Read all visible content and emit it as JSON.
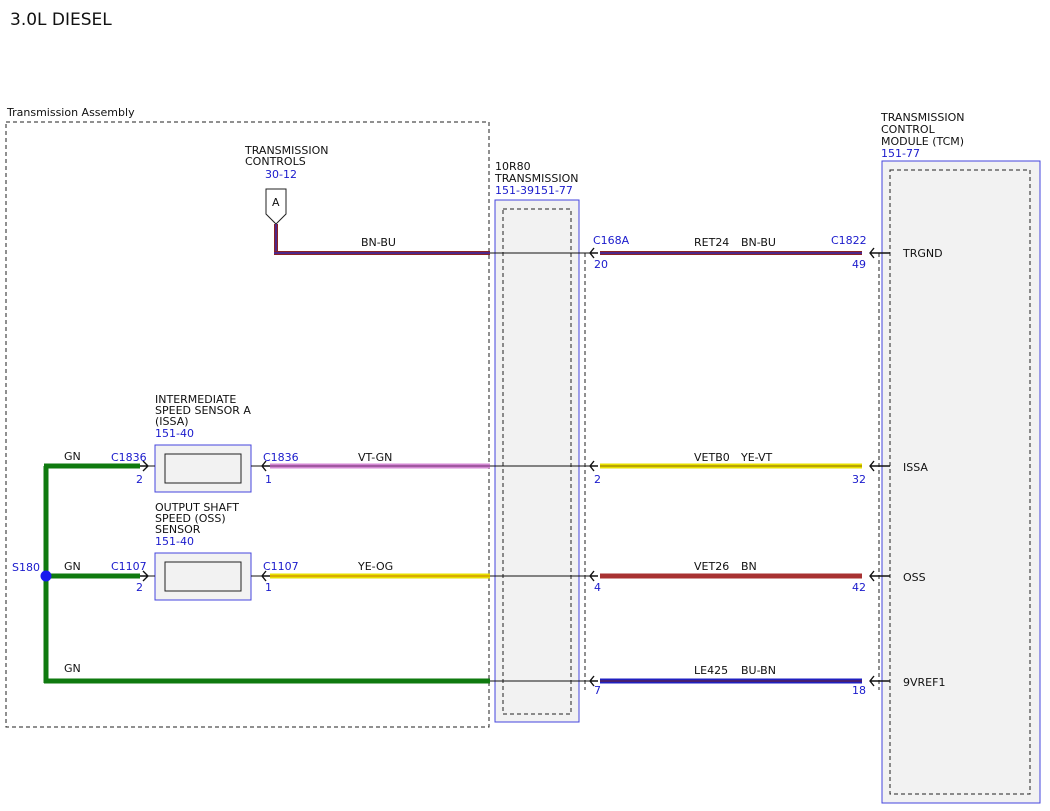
{
  "title": "3.0L DIESEL",
  "transmission_assembly": {
    "label": "Transmission Assembly"
  },
  "transmission_controls": {
    "name_line1": "TRANSMISSION",
    "name_line2": "CONTROLS",
    "ref": "30-12",
    "marker": "A"
  },
  "transmission_10r80": {
    "name_line1": "10R80",
    "name_line2": "TRANSMISSION",
    "ref": "151-39151-77"
  },
  "tcm": {
    "name_line1": "TRANSMISSION",
    "name_line2": "CONTROL",
    "name_line3": "MODULE (TCM)",
    "ref": "151-77"
  },
  "issa_sensor": {
    "name_line1": "INTERMEDIATE",
    "name_line2": "SPEED SENSOR A",
    "name_line3": "(ISSA)",
    "ref": "151-40",
    "left_connector": "C1836",
    "left_pin": "2",
    "right_connector": "C1836",
    "right_pin": "1"
  },
  "oss_sensor": {
    "name_line1": "OUTPUT SHAFT",
    "name_line2": "SPEED (OSS)",
    "name_line3": "SENSOR",
    "ref": "151-40",
    "left_connector": "C1107",
    "left_pin": "2",
    "right_connector": "C1107",
    "right_pin": "1"
  },
  "splice": {
    "label": "S180"
  },
  "wires": {
    "gn_top": "GN",
    "gn_mid": "GN",
    "gn_bottom": "GN",
    "bn_bu": "BN-BU",
    "vt_gn": "VT-GN",
    "ye_og": "YE-OG"
  },
  "c168a": {
    "label": "C168A"
  },
  "c1822": {
    "label": "C1822"
  },
  "circuits": [
    {
      "circuit": "RET24",
      "color": "BN-BU",
      "pin_left": "20",
      "pin_right": "49",
      "signal": "TRGND"
    },
    {
      "circuit": "VETB0",
      "color": "YE-VT",
      "pin_left": "2",
      "pin_right": "32",
      "signal": "ISSA"
    },
    {
      "circuit": "VET26",
      "color": "BN",
      "pin_left": "4",
      "pin_right": "42",
      "signal": "OSS"
    },
    {
      "circuit": "LE425",
      "color": "BU-BN",
      "pin_left": "7",
      "pin_right": "18",
      "signal": "9VREF1"
    }
  ],
  "colors": {
    "green": "#0f7a0f",
    "brown_blue_outer": "#8b2323",
    "brown_blue_inner": "#2a2ac8",
    "violet": "#d488d4",
    "yellow": "#e8e000",
    "brown": "#a83232",
    "blue": "#2020c0",
    "connector_blue": "#1a1acc"
  }
}
